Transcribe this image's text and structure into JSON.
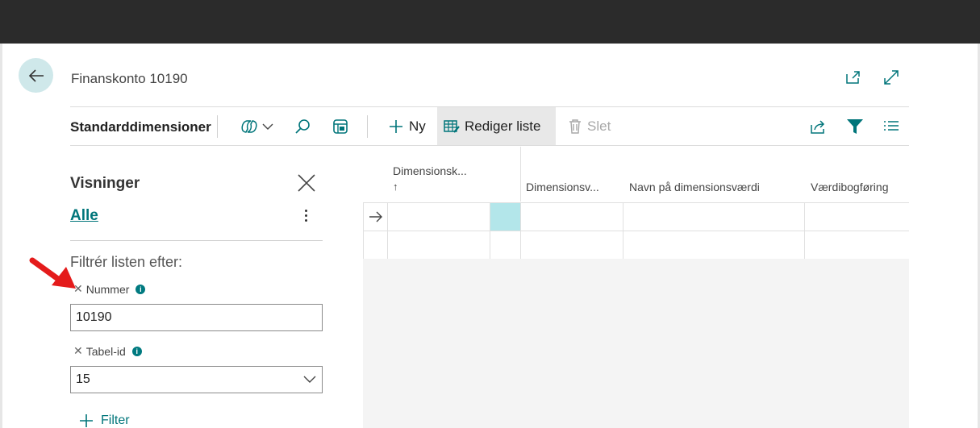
{
  "header": {
    "title": "Finanskonto 10190"
  },
  "toolbar": {
    "title": "Standarddimensioner",
    "new_label": "Ny",
    "edit_list_label": "Rediger liste",
    "delete_label": "Slet"
  },
  "sidebar": {
    "title": "Visninger",
    "view_link": "Alle",
    "filter_heading": "Filtrér listen efter:",
    "filters": [
      {
        "label": "Nummer",
        "value": "10190"
      },
      {
        "label": "Tabel-id",
        "value": "15"
      }
    ],
    "add_filter_label": "Filter"
  },
  "table": {
    "columns": [
      "Dimensionsk...",
      "Dimensionsv...",
      "Navn på dimensionsværdi",
      "Værdibogføring"
    ],
    "sort_indicator": "↑"
  },
  "colors": {
    "accent": "#00757a",
    "selected_cell": "#b3e6ea",
    "topbar": "#2b2b2b"
  },
  "icons": [
    "back-arrow-icon",
    "open-new-window-icon",
    "expand-icon",
    "copilot-icon",
    "chevron-down-icon",
    "search-icon",
    "personalize-icon",
    "plus-icon",
    "edit-list-icon",
    "delete-icon",
    "share-icon",
    "filter-icon",
    "list-view-icon",
    "close-icon",
    "more-options-icon",
    "info-icon",
    "row-arrow-icon"
  ]
}
